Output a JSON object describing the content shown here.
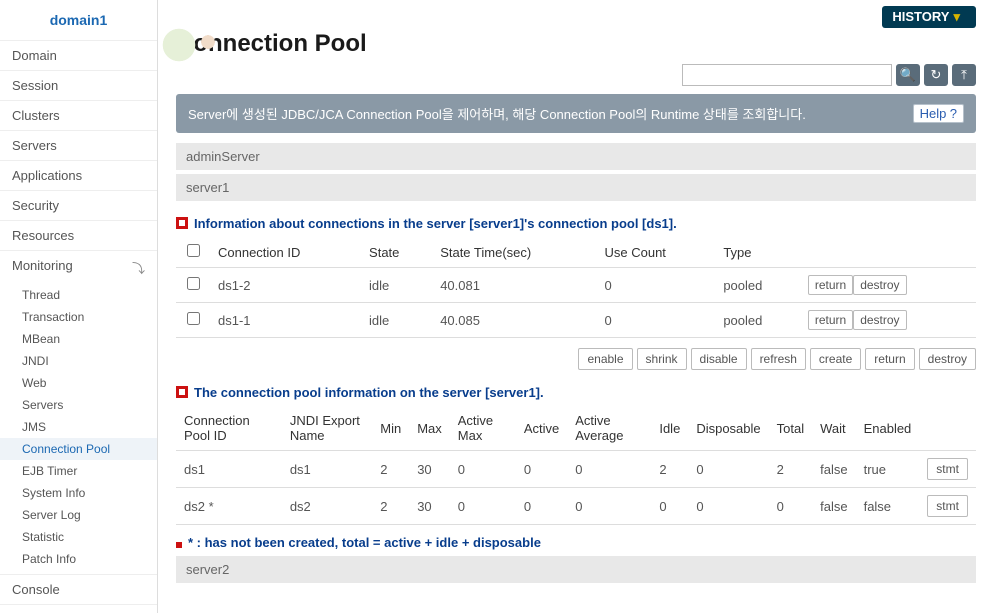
{
  "domain": "domain1",
  "nav1": [
    {
      "label": "Domain"
    },
    {
      "label": "Session"
    },
    {
      "label": "Clusters"
    },
    {
      "label": "Servers"
    },
    {
      "label": "Applications"
    },
    {
      "label": "Security"
    },
    {
      "label": "Resources"
    },
    {
      "label": "Monitoring",
      "children": [
        {
          "label": "Thread"
        },
        {
          "label": "Transaction"
        },
        {
          "label": "MBean"
        },
        {
          "label": "JNDI"
        },
        {
          "label": "Web"
        },
        {
          "label": "Servers"
        },
        {
          "label": "JMS"
        },
        {
          "label": "Connection Pool",
          "active": true
        },
        {
          "label": "EJB Timer"
        },
        {
          "label": "System Info"
        },
        {
          "label": "Server Log"
        },
        {
          "label": "Statistic"
        },
        {
          "label": "Patch Info"
        }
      ]
    },
    {
      "label": "Console"
    }
  ],
  "history": "HISTORY",
  "pageTitle": "Connection Pool",
  "descBanner": "Server에 생성된 JDBC/JCA Connection Pool을 제어하며, 해당 Connection Pool의 Runtime 상태를 조회합니다.",
  "helpLabel": "Help",
  "additionalBars": [
    "adminServer",
    "server1"
  ],
  "sec1Title": "Information about connections in the server [server1]'s connection pool [ds1].",
  "sec1Cols": [
    "",
    "Connection ID",
    "State",
    "State Time(sec)",
    "Use Count",
    "Type",
    ""
  ],
  "sec1Rows": [
    {
      "id": "ds1-2",
      "state": "idle",
      "time": "40.081",
      "use": "0",
      "type": "pooled"
    },
    {
      "id": "ds1-1",
      "state": "idle",
      "time": "40.085",
      "use": "0",
      "type": "pooled"
    }
  ],
  "rowActionLabels": {
    "return": "return",
    "destroy": "destroy"
  },
  "poolActions": [
    "enable",
    "shrink",
    "disable",
    "refresh",
    "create",
    "return",
    "destroy"
  ],
  "sec2Title": "The connection pool information on the server [server1].",
  "sec2Cols": [
    "Connection Pool ID",
    "JNDI Export Name",
    "Min",
    "Max",
    "Active Max",
    "Active",
    "Active Average",
    "Idle",
    "Disposable",
    "Total",
    "Wait",
    "Enabled",
    ""
  ],
  "sec2Rows": [
    {
      "cpid": "ds1",
      "jndi": "ds1",
      "min": "2",
      "max": "30",
      "amax": "0",
      "active": "0",
      "aavg": "0",
      "idle": "2",
      "disp": "0",
      "total": "2",
      "wait": "false",
      "enabled": "true"
    },
    {
      "cpid": "ds2 *",
      "jndi": "ds2",
      "min": "2",
      "max": "30",
      "amax": "0",
      "active": "0",
      "aavg": "0",
      "idle": "0",
      "disp": "0",
      "total": "0",
      "wait": "false",
      "enabled": "false"
    }
  ],
  "stmtLabel": "stmt",
  "note": "* : has not been created, total = active + idle + disposable",
  "afterBar": "server2",
  "searchPlaceholder": ""
}
